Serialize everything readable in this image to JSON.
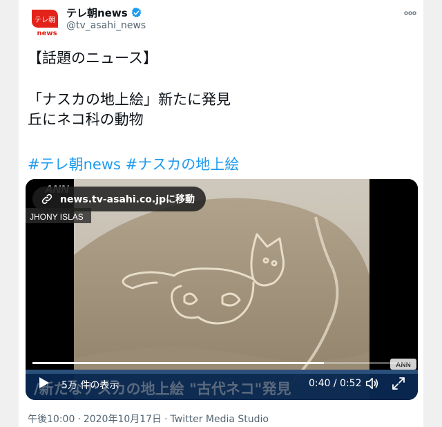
{
  "account": {
    "display_name": "テレ朝news",
    "handle": "@tv_asahi_news",
    "avatar_text_top": "テレ朝",
    "avatar_text_bottom": "news",
    "verified": true,
    "colors": {
      "brand_red": "#e32219",
      "verified_blue": "#1d9bf0"
    }
  },
  "tweet": {
    "line1": "【話題のニュース】",
    "line2": "「ナスカの地上絵」新たに発見",
    "line3": "丘にネコ科の動物",
    "hashtags": [
      "#テレ朝news",
      "#ナスカの地上絵"
    ]
  },
  "media": {
    "link_label": "news.tv-asahi.co.jpに移動",
    "views": "5万 件の表示",
    "time": "0:40 / 0:52",
    "progress": 0.77,
    "watermark_top": "ANN",
    "watermark_bottom": "ANN",
    "credit": "JHONY ISLAS",
    "caption": "/新たなナスカの地上絵 \"古代ネコ\"発見"
  },
  "footer": {
    "time": "午後10:00",
    "date": "2020年10月17日",
    "source": "Twitter Media Studio"
  }
}
